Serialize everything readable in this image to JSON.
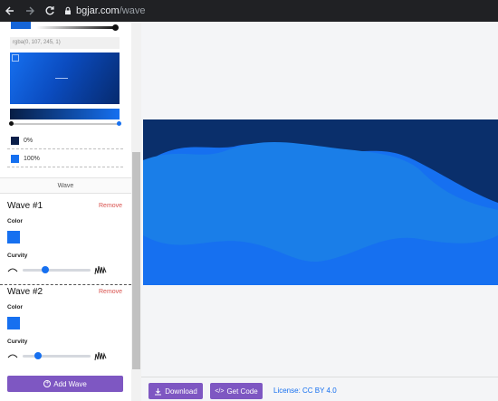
{
  "browser": {
    "url_host": "bgjar.com",
    "url_path": "/wave"
  },
  "sidebar": {
    "color_picker": {
      "rgba_value": "rgba(0, 107, 245, 1)"
    },
    "gradient_stops": [
      {
        "label": "0%",
        "color": "#0b1f4a"
      },
      {
        "label": "100%",
        "color": "#1670f0"
      }
    ],
    "section_title": "Wave",
    "waves": [
      {
        "title": "Wave #1",
        "remove_label": "Remove",
        "color_label": "Color",
        "curvity_label": "Curvity",
        "color": "#1670f0",
        "curvity": 0.33
      },
      {
        "title": "Wave #2",
        "remove_label": "Remove",
        "color_label": "Color",
        "curvity_label": "Curvity",
        "color": "#1670f0",
        "curvity": 0.2
      }
    ],
    "add_wave_label": "Add Wave"
  },
  "footer": {
    "download_label": "Download",
    "get_code_label": "Get Code",
    "license_label": "License: CC BY 4.0"
  },
  "colors": {
    "accent_purple": "#7e57c2",
    "wave_dark": "#0a2f6b",
    "wave_mid": "#1670f0",
    "wave_light": "#1a7ee8",
    "remove_red": "#d9534f"
  }
}
